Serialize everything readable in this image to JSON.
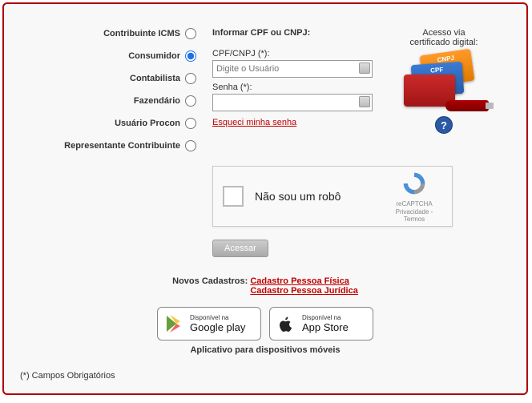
{
  "profiles": [
    {
      "id": "contribuinte-icms",
      "label": "Contribuinte ICMS",
      "selected": false
    },
    {
      "id": "consumidor",
      "label": "Consumidor",
      "selected": true
    },
    {
      "id": "contabilista",
      "label": "Contabilista",
      "selected": false
    },
    {
      "id": "fazendario",
      "label": "Fazendário",
      "selected": false
    },
    {
      "id": "usuario-procon",
      "label": "Usuário Procon",
      "selected": false
    },
    {
      "id": "representante-contribuinte",
      "label": "Representante Contribuinte",
      "selected": false
    }
  ],
  "login": {
    "section_title": "Informar CPF ou CNPJ:",
    "cpf_label": "CPF/CNPJ (*):",
    "cpf_placeholder": "Digite o Usuário",
    "senha_label": "Senha (*):",
    "forgot": "Esqueci minha senha",
    "access_button": "Acessar"
  },
  "cert": {
    "line1": "Acesso via",
    "line2": "certificado digital:"
  },
  "recaptcha": {
    "text": "Não sou um robô",
    "brand": "reCAPTCHA",
    "privacy": "Privacidade - Termos"
  },
  "new_reg": {
    "label": "Novos Cadastros:",
    "link_pf": "Cadastro Pessoa Física",
    "link_pj": "Cadastro Pessoa Jurídica"
  },
  "stores": {
    "google_small": "Disponível na",
    "google_big": "Google play",
    "apple_small": "Disponível na",
    "apple_big": "App Store"
  },
  "apps_caption": "Aplicativo para dispositivos móveis",
  "footnote": "(*) Campos Obrigatórios"
}
